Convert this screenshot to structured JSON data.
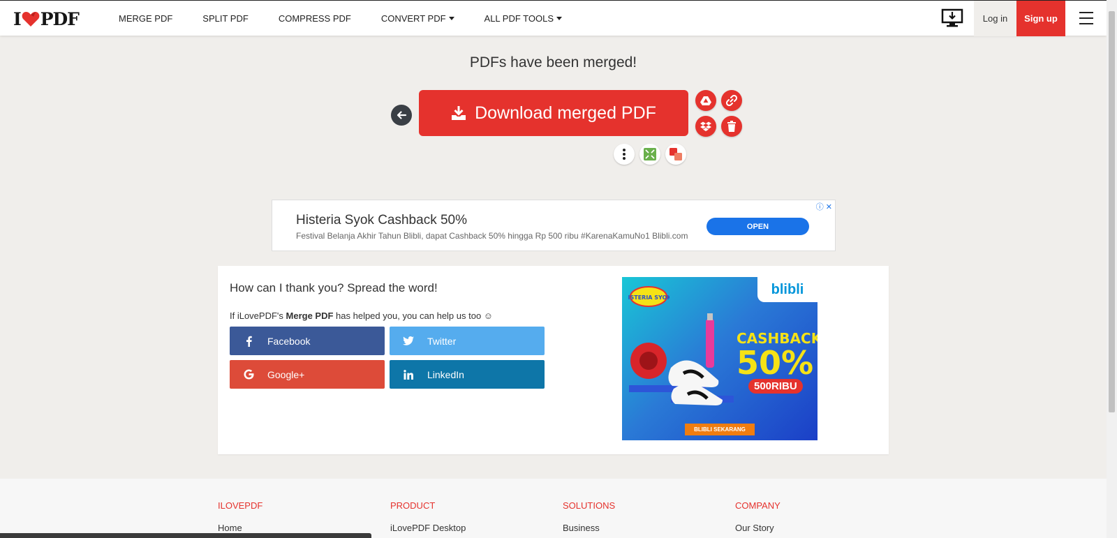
{
  "brand": {
    "logo_left": "I",
    "logo_right": "PDF",
    "accent": "#e5322d"
  },
  "nav": {
    "items": [
      {
        "label": "MERGE PDF",
        "dropdown": false
      },
      {
        "label": "SPLIT PDF",
        "dropdown": false
      },
      {
        "label": "COMPRESS PDF",
        "dropdown": false
      },
      {
        "label": "CONVERT PDF",
        "dropdown": true
      },
      {
        "label": "ALL PDF TOOLS",
        "dropdown": true
      }
    ],
    "login": "Log in",
    "signup": "Sign up",
    "desktop_icon": "desktop-download-icon",
    "menu_icon": "hamburger-menu-icon"
  },
  "result": {
    "title": "PDFs have been merged!",
    "download_label": "Download merged PDF",
    "actions": [
      "google-drive-icon",
      "link-icon",
      "dropbox-icon",
      "trash-icon"
    ],
    "more_actions": [
      "more-vertical-icon",
      "compress-icon",
      "split-icon"
    ]
  },
  "ad_banner": {
    "title": "Histeria Syok Cashback 50%",
    "description": "Festival Belanja Akhir Tahun Blibli, dapat Cashback 50% hingga Rp 500 ribu #KarenaKamuNo1 Blibli.com",
    "cta": "OPEN"
  },
  "share": {
    "heading": "How can I thank you? Spread the word!",
    "helped_prefix": "If iLovePDF's ",
    "helped_tool": "Merge PDF",
    "helped_suffix": " has helped you, you can help us too ☺",
    "buttons": [
      {
        "label": "Facebook",
        "icon": "facebook-icon"
      },
      {
        "label": "Twitter",
        "icon": "twitter-icon"
      },
      {
        "label": "Google+",
        "icon": "google-plus-icon"
      },
      {
        "label": "LinkedIn",
        "icon": "linkedin-icon"
      }
    ]
  },
  "display_ad": {
    "brand": "blibli",
    "badge": "HISTERIA SYOK!",
    "headline": "CASHBACK",
    "percent": "50%",
    "amount": "500RIBU",
    "cta": "BLIBLI SEKARANG"
  },
  "footer": {
    "columns": [
      {
        "heading": "ILOVEPDF",
        "link": "Home"
      },
      {
        "heading": "PRODUCT",
        "link": "iLovePDF Desktop"
      },
      {
        "heading": "SOLUTIONS",
        "link": "Business"
      },
      {
        "heading": "COMPANY",
        "link": "Our Story"
      }
    ]
  }
}
